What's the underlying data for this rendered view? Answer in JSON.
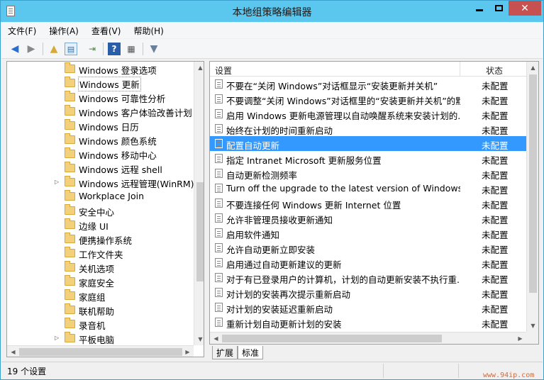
{
  "window": {
    "title": "本地组策略编辑器",
    "min_label": "—",
    "max_label": "□",
    "close_label": "✕"
  },
  "menu": {
    "items": [
      "文件(F)",
      "操作(A)",
      "查看(V)",
      "帮助(H)"
    ]
  },
  "toolbar": {
    "icons": [
      "back-icon",
      "forward-icon",
      "up-folder-icon",
      "show-hide-tree-icon",
      "export-list-icon",
      "help-icon",
      "properties-icon",
      "filter-icon"
    ]
  },
  "tree": {
    "items": [
      {
        "label": "Windows 登录选项",
        "expandable": false,
        "selected": false
      },
      {
        "label": "Windows 更新",
        "expandable": false,
        "selected": true
      },
      {
        "label": "Windows 可靠性分析",
        "expandable": false,
        "selected": false
      },
      {
        "label": "Windows 客户体验改善计划",
        "expandable": false,
        "selected": false
      },
      {
        "label": "Windows 日历",
        "expandable": false,
        "selected": false
      },
      {
        "label": "Windows 颜色系统",
        "expandable": false,
        "selected": false
      },
      {
        "label": "Windows 移动中心",
        "expandable": false,
        "selected": false
      },
      {
        "label": "Windows 远程 shell",
        "expandable": false,
        "selected": false
      },
      {
        "label": "Windows 远程管理(WinRM)",
        "expandable": true,
        "selected": false
      },
      {
        "label": "Workplace Join",
        "expandable": false,
        "selected": false
      },
      {
        "label": "安全中心",
        "expandable": false,
        "selected": false
      },
      {
        "label": "边缘 UI",
        "expandable": false,
        "selected": false
      },
      {
        "label": "便携操作系统",
        "expandable": false,
        "selected": false
      },
      {
        "label": "工作文件夹",
        "expandable": false,
        "selected": false
      },
      {
        "label": "关机选项",
        "expandable": false,
        "selected": false
      },
      {
        "label": "家庭安全",
        "expandable": false,
        "selected": false
      },
      {
        "label": "家庭组",
        "expandable": false,
        "selected": false
      },
      {
        "label": "联机帮助",
        "expandable": false,
        "selected": false
      },
      {
        "label": "录音机",
        "expandable": false,
        "selected": false
      },
      {
        "label": "平板电脑",
        "expandable": true,
        "selected": false
      }
    ]
  },
  "list": {
    "col_setting": "设置",
    "col_state": "状态",
    "rows": [
      {
        "name": "不要在“关闭 Windows”对话框显示“安装更新并关机”",
        "state": "未配置",
        "selected": false
      },
      {
        "name": "不要调整“关闭 Windows”对话框里的“安装更新并关机”的默...",
        "state": "未配置",
        "selected": false
      },
      {
        "name": "启用 Windows 更新电源管理以自动唤醒系统来安装计划的...",
        "state": "未配置",
        "selected": false
      },
      {
        "name": "始终在计划的时间重新启动",
        "state": "未配置",
        "selected": false
      },
      {
        "name": "配置自动更新",
        "state": "未配置",
        "selected": true
      },
      {
        "name": "指定 Intranet Microsoft 更新服务位置",
        "state": "未配置",
        "selected": false
      },
      {
        "name": "自动更新检测频率",
        "state": "未配置",
        "selected": false
      },
      {
        "name": "Turn off the upgrade to the latest version of Windows...",
        "state": "未配置",
        "selected": false
      },
      {
        "name": "不要连接任何 Windows 更新 Internet 位置",
        "state": "未配置",
        "selected": false
      },
      {
        "name": "允许非管理员接收更新通知",
        "state": "未配置",
        "selected": false
      },
      {
        "name": "启用软件通知",
        "state": "未配置",
        "selected": false
      },
      {
        "name": "允许自动更新立即安装",
        "state": "未配置",
        "selected": false
      },
      {
        "name": "启用通过自动更新建议的更新",
        "state": "未配置",
        "selected": false
      },
      {
        "name": "对于有已登录用户的计算机，计划的自动更新安装不执行重...",
        "state": "未配置",
        "selected": false
      },
      {
        "name": "对计划的安装再次提示重新启动",
        "state": "未配置",
        "selected": false
      },
      {
        "name": "对计划的安装延迟重新启动",
        "state": "未配置",
        "selected": false
      },
      {
        "name": "重新计划自动更新计划的安装",
        "state": "未配置",
        "selected": false
      }
    ]
  },
  "tabs": {
    "extended": "扩展",
    "standard": "标准"
  },
  "status": {
    "text": "19 个设置"
  },
  "watermark": "www.94ip.com",
  "colors": {
    "titlebar": "#5bc6ee",
    "selection": "#3399ff",
    "close_button": "#c75050"
  }
}
